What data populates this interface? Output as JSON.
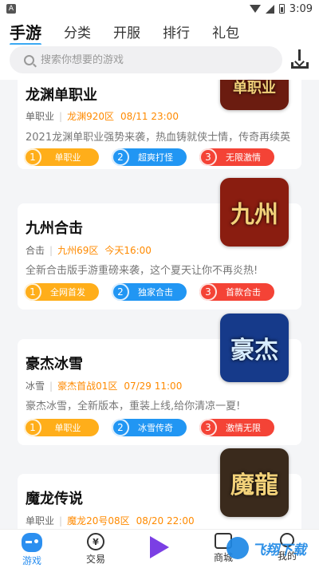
{
  "status_bar": {
    "app_icon": "A",
    "time": "3:09"
  },
  "top_tabs": [
    "手游",
    "分类",
    "开服",
    "排行",
    "礼包"
  ],
  "search": {
    "placeholder": "搜索你想要的游戏"
  },
  "games": [
    {
      "title": "龙渊单职业",
      "type": "单职业",
      "server": "龙渊920区",
      "time": "08/11 23:00",
      "desc": "2021龙渊单职业强势来袭，热血铸就侠士情，传奇再续英",
      "tags": [
        {
          "num": "1",
          "label": "单职业"
        },
        {
          "num": "2",
          "label": "超爽打怪"
        },
        {
          "num": "3",
          "label": "无限激情"
        }
      ],
      "cover_text": "单职业",
      "cover_color": "#6b1c10"
    },
    {
      "title": "九州合击",
      "type": "合击",
      "server": "九州69区",
      "time": "今天16:00",
      "desc": "全新合击版手游重磅来袭，这个夏天让你不再炎热!",
      "tags": [
        {
          "num": "1",
          "label": "全网首发"
        },
        {
          "num": "2",
          "label": "独家合击"
        },
        {
          "num": "3",
          "label": "首款合击"
        }
      ],
      "cover_text": "九州",
      "cover_color": "#8a1d10"
    },
    {
      "title": "豪杰冰雪",
      "type": "冰雪",
      "server": "豪杰首战01区",
      "time": "07/29 11:00",
      "desc": "豪杰冰雪，全新版本，重装上线,给你清凉一夏!",
      "tags": [
        {
          "num": "1",
          "label": "单职业"
        },
        {
          "num": "2",
          "label": "冰雪传奇"
        },
        {
          "num": "3",
          "label": "激情无限"
        }
      ],
      "cover_text": "豪杰",
      "cover_color": "#163a8a"
    },
    {
      "title": "魔龙传说",
      "type": "单职业",
      "server": "魔龙20号08区",
      "time": "08/20 22:00",
      "desc": "",
      "tags": [],
      "cover_text": "魔龍",
      "cover_color": "#3a2a1c"
    }
  ],
  "bottom_nav": [
    "游戏",
    "交易",
    "",
    "商城",
    "我的"
  ],
  "watermark": "飞翔下载",
  "colors": {
    "accent": "#2b8ff0",
    "tag1": "#ffae1a",
    "tag2": "#2196f3",
    "tag3": "#f44336",
    "orange_text": "#ff8a00"
  }
}
